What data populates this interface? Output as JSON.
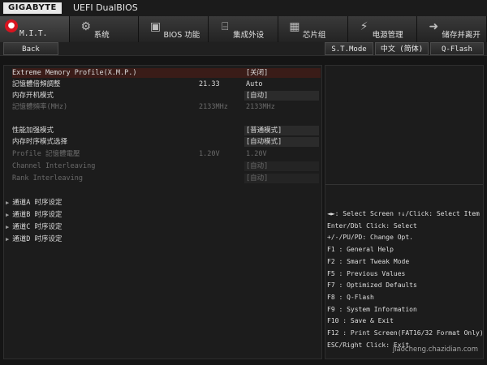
{
  "brand": "GIGABYTE",
  "app_title": "UEFI DualBIOS",
  "tabs": [
    {
      "label": "M.I.T.",
      "icon": "speedometer-icon",
      "active": true
    },
    {
      "label": "系统",
      "icon": "gear-icon"
    },
    {
      "label": "BIOS 功能",
      "icon": "bios-chip-icon"
    },
    {
      "label": "集成外设",
      "icon": "peripherals-icon"
    },
    {
      "label": "芯片组",
      "icon": "chipset-icon"
    },
    {
      "label": "电源管理",
      "icon": "power-icon"
    },
    {
      "label": "储存并离开",
      "icon": "save-exit-icon"
    }
  ],
  "subbar": {
    "back": "Back",
    "st_mode": "S.T.Mode",
    "language": "中文 (简体)",
    "qflash": "Q-Flash"
  },
  "settings": [
    {
      "label": "Extreme Memory Profile(X.M.P.)",
      "value": "[关闭]",
      "selected": true
    },
    {
      "label": "記憶體倍頻調整",
      "mid": "21.33",
      "value": "Auto",
      "plain": true
    },
    {
      "label": "内存开机模式",
      "value": "[自动]"
    },
    {
      "label": "記憶體頻率(MHz)",
      "mid": "2133MHz",
      "value": "2133MHz",
      "dim": true,
      "plain": true
    },
    {
      "label": "性能加强模式",
      "value": "[普通模式]"
    },
    {
      "label": "内存时序模式选择",
      "value": "[自动模式]"
    },
    {
      "label": "Profile 記憶體電壓",
      "mid": "1.20V",
      "value": "1.20V",
      "dim": true,
      "plain": true
    },
    {
      "label": "Channel Interleaving",
      "value": "[自动]",
      "dim": true
    },
    {
      "label": "Rank Interleaving",
      "value": "[自动]",
      "dim": true
    }
  ],
  "submenus": [
    "通道A 时序设定",
    "通道B 时序设定",
    "通道C 时序设定",
    "通道D 时序设定"
  ],
  "help": [
    "◄►: Select Screen  ↑↓/Click: Select Item",
    "Enter/Dbl Click: Select",
    "+/-/PU/PD: Change Opt.",
    "F1  : General Help",
    "F2  : Smart Tweak Mode",
    "F5  : Previous Values",
    "F7  : Optimized Defaults",
    "F8  : Q-Flash",
    "F9  : System Information",
    "F10 : Save & Exit",
    "F12 : Print Screen(FAT16/32 Format Only)",
    "ESC/Right Click: Exit"
  ],
  "watermark": "jiaocheng.chazidian.com"
}
